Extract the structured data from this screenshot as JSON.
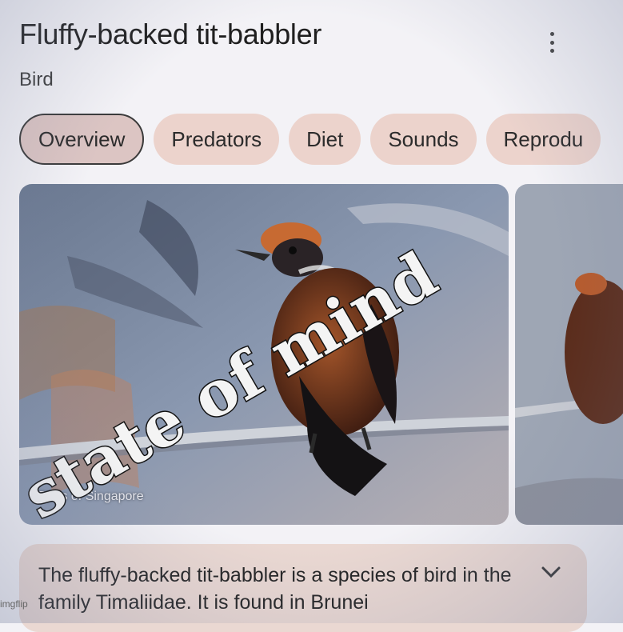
{
  "header": {
    "title": "Fluffy-backed tit-babbler",
    "subtitle": "Bird"
  },
  "tabs": [
    {
      "label": "Overview",
      "active": true
    },
    {
      "label": "Predators",
      "active": false
    },
    {
      "label": "Diet",
      "active": false
    },
    {
      "label": "Sounds",
      "active": false
    },
    {
      "label": "Reprodu",
      "active": false
    }
  ],
  "gallery": {
    "caption": "Birds of Singapore"
  },
  "overlay_text": "state of mind",
  "description": {
    "text": "The fluffy-backed tit-babbler is a species of bird in the family Timaliidae. It is found in Brunei"
  },
  "watermark": "imgflip",
  "icons": {
    "menu": "more-vert-icon",
    "expand": "chevron-down-icon"
  },
  "colors": {
    "tab_bg": "#ecd3cc",
    "tab_active_bg": "#dcc5c3",
    "desc_bg": "#ead8d2"
  }
}
